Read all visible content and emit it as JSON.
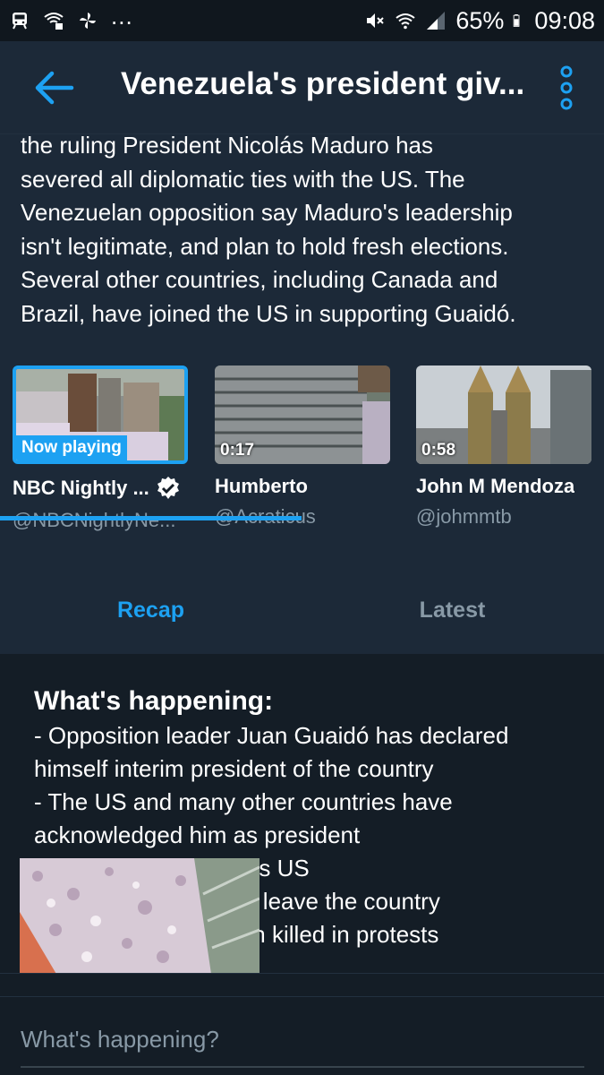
{
  "status_bar": {
    "battery": "65%",
    "time": "09:08",
    "dots": "..."
  },
  "header": {
    "title": "Venezuela's president giv..."
  },
  "paragraph": [
    "the ruling President Nicolás Maduro has",
    "severed all diplomatic ties with the US. The",
    "Venezuelan opposition say Maduro's leadership",
    "isn't legitimate, and plan to hold fresh elections.",
    "Several other countries, including Canada and",
    "Brazil, have joined the US in supporting Guaidó."
  ],
  "videos": [
    {
      "name": "NBC Nightly ...",
      "handle": "@NBCNightlyNe...",
      "badge": "Now playing",
      "verified": true
    },
    {
      "name": "Humberto",
      "handle": "@Acraticus",
      "badge": "0:17",
      "verified": false
    },
    {
      "name": "John M Mendoza",
      "handle": "@johmmtb",
      "badge": "0:58",
      "verified": false
    }
  ],
  "tabs": {
    "recap": "Recap",
    "latest": "Latest"
  },
  "recap": {
    "heading": "What's happening:",
    "lines": [
      "- Opposition leader Juan Guaidó has declared",
      "himself interim president of the country",
      "- The US and many other countries have",
      "acknowledged him as president",
      "- Nicolas Maduro gives US",
      "diplomats 72 hours to leave the country",
      "- 26 people have been killed in protests"
    ]
  },
  "composer": {
    "placeholder": "What's happening?"
  },
  "colors": {
    "accent": "#1da1f2",
    "background": "#141d26",
    "surface": "#1c2938",
    "muted_text": "#8899a6"
  }
}
